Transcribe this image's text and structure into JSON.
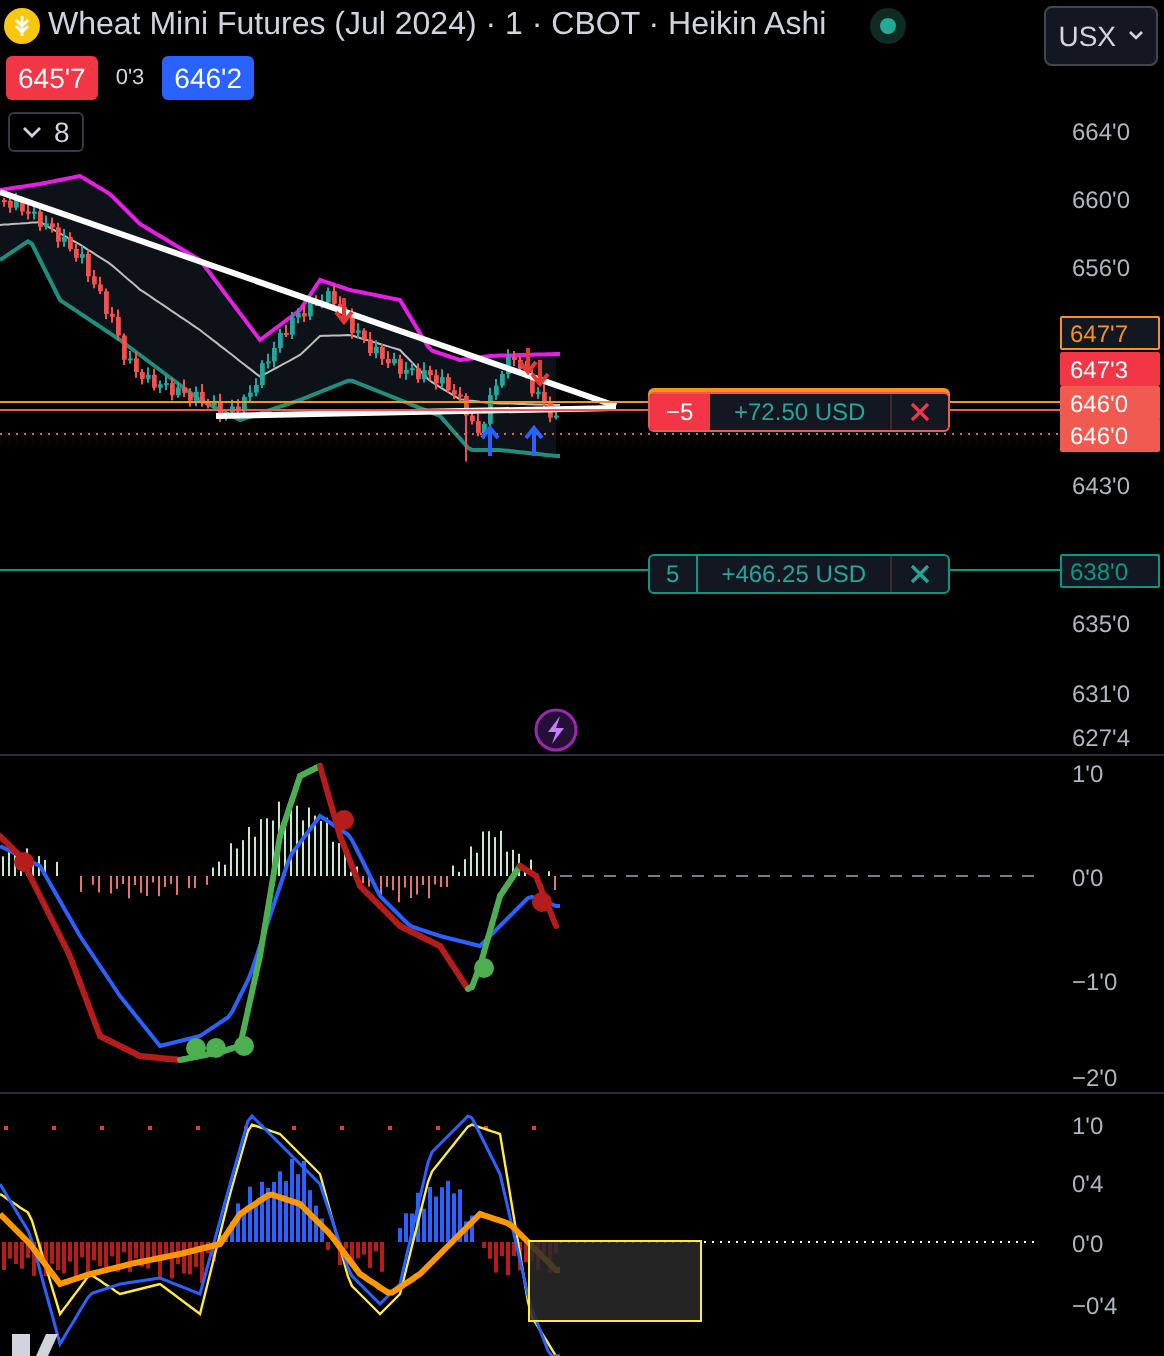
{
  "header": {
    "title": "Wheat Mini Futures (Jul 2024) · 1 · CBOT · Heikin Ashi",
    "market_open": true,
    "currency": "USX"
  },
  "quote": {
    "bid": "645'7",
    "spread": "0'3",
    "ask": "646'2"
  },
  "indicators": {
    "count": "8",
    "expanded": false
  },
  "positions": [
    {
      "kind": "short",
      "qty": "−5",
      "pnl": "+72.50 USD"
    },
    {
      "kind": "long",
      "qty": "5",
      "pnl": "+466.25 USD"
    }
  ],
  "price_axis": [
    {
      "label": "664'0",
      "kind": "tick"
    },
    {
      "label": "660'0",
      "kind": "tick"
    },
    {
      "label": "656'0",
      "kind": "tick"
    },
    {
      "label": "647'7",
      "kind": "outline",
      "color": "#f7931a"
    },
    {
      "label": "647'3",
      "kind": "filled",
      "color": "#f23645"
    },
    {
      "label": "646'0",
      "kind": "filled",
      "color": "#f05a50"
    },
    {
      "label": "646'0",
      "kind": "filled",
      "color": "#f05a50"
    },
    {
      "label": "643'0",
      "kind": "tick"
    },
    {
      "label": "638'0",
      "kind": "outline",
      "color": "#089981"
    },
    {
      "label": "635'0",
      "kind": "tick"
    },
    {
      "label": "631'0",
      "kind": "tick"
    },
    {
      "label": "627'4",
      "kind": "tick"
    }
  ],
  "oscillator_axis": [
    {
      "label": "1'0"
    },
    {
      "label": "0'0"
    },
    {
      "label": "−1'0"
    },
    {
      "label": "−2'0"
    }
  ],
  "momentum_axis": [
    {
      "label": "1'0"
    },
    {
      "label": "0'4"
    },
    {
      "label": "0'0"
    },
    {
      "label": "−0'4"
    }
  ]
}
